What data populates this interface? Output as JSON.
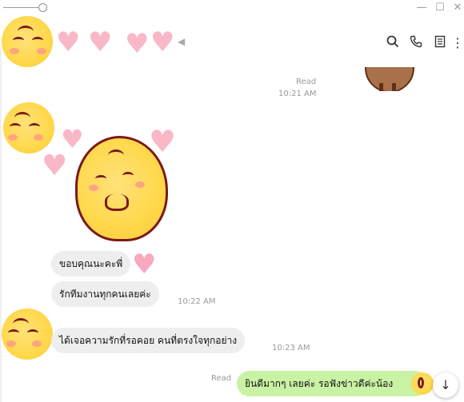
{
  "window": {
    "minimize_icon": "minimize-icon",
    "maximize_icon": "maximize-icon",
    "close_icon": "close-icon"
  },
  "header": {
    "contact_display": "chick-and-hearts-avatar",
    "muted_icon": "speaker-muted-icon",
    "actions": [
      "search-icon",
      "phone-icon",
      "notes-icon",
      "more-vertical-icon"
    ]
  },
  "messages": [
    {
      "id": "m0",
      "sender": "me",
      "type": "sticker",
      "read_label": "Read",
      "time": "10:21 AM"
    },
    {
      "id": "m1",
      "sender": "contact",
      "type": "sticker"
    },
    {
      "id": "m2",
      "sender": "contact",
      "type": "text",
      "text": "ขอบคุณนะคะพี่"
    },
    {
      "id": "m3",
      "sender": "contact",
      "type": "text",
      "text": "รักทีมงานทุกคนเลยค่ะ",
      "time": "10:22 AM"
    },
    {
      "id": "m4",
      "sender": "contact",
      "type": "text",
      "text": "ได้เจอความรักที่รอคอย คนที่ตรงใจทุกอย่าง",
      "time": "10:23 AM"
    },
    {
      "id": "m5",
      "sender": "me",
      "type": "text",
      "text": "ยินดีมากๆ เลยค่ะ รอฟังข่าวดีค่ะน้อง",
      "read_label": "Read"
    }
  ],
  "scroll_down_icon": "arrow-down-icon",
  "colors": {
    "my_bubble": "#c9f2a4",
    "their_bubble": "#eeeeee",
    "heart": "#f9b8c8",
    "chick": "#ffd84a"
  }
}
